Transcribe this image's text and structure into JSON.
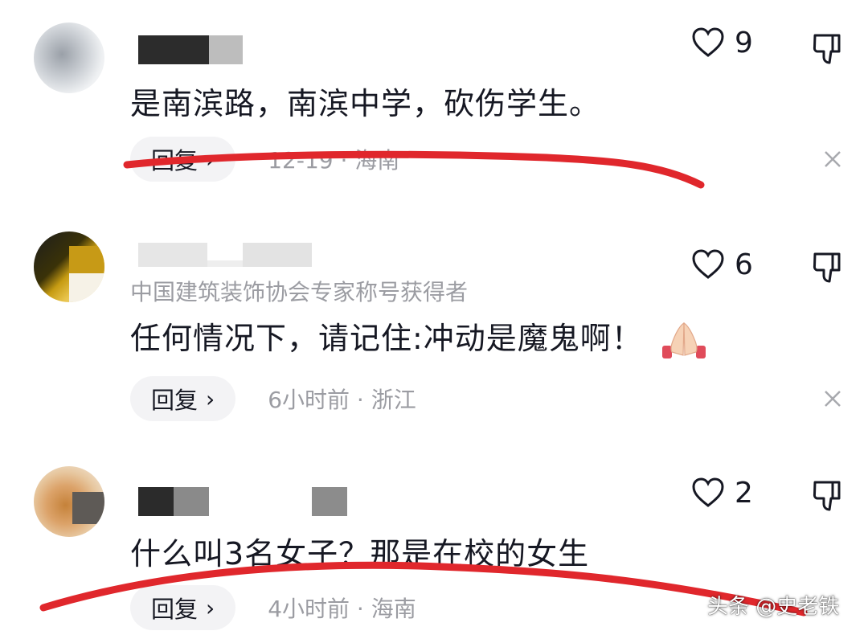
{
  "comments": [
    {
      "text": "是南滨路，南滨中学，砍伤学生。",
      "likes": "9",
      "reply_label": "回复",
      "reply_arrow": "›",
      "meta": "12-19 · 海南"
    },
    {
      "subtitle": "中国建筑装饰协会专家称号获得者",
      "text": "任何情况下，请记住:冲动是魔鬼啊！",
      "emoji": "folded-hands",
      "likes": "6",
      "reply_label": "回复",
      "reply_arrow": "›",
      "meta": "6小时前 · 浙江"
    },
    {
      "text": "什么叫3名女子？那是在校的女生",
      "likes": "2",
      "reply_label": "回复",
      "reply_arrow": "›",
      "meta": "4小时前 · 海南"
    }
  ],
  "watermark": "头条 @史老铁",
  "colors": {
    "annotation_red": "#e0272c",
    "meta_gray": "#9b9ca2",
    "text": "#161823"
  }
}
